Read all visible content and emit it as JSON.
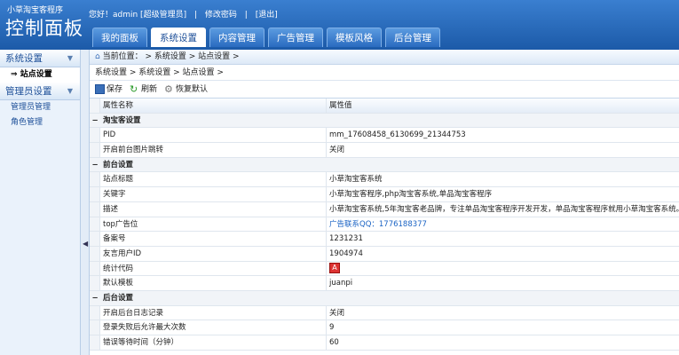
{
  "header": {
    "subtitle": "小草淘宝客程序",
    "title": "控制面板",
    "greeting": "您好！admin [超级管理员]",
    "change_password": "修改密码",
    "logout": "[退出]"
  },
  "nav": [
    "我的面板",
    "系统设置",
    "内容管理",
    "广告管理",
    "模板风格",
    "后台管理"
  ],
  "sidebar": {
    "section1": "系统设置",
    "section1_items": [
      "站点设置"
    ],
    "section2": "管理员设置",
    "section2_items": [
      "管理员管理",
      "角色管理"
    ]
  },
  "location": "当前位置： > 系统设置 > 站点设置 >",
  "breadcrumb": "系统设置 > 系统设置 > 站点设置 >",
  "toolbar": {
    "save": "保存",
    "refresh": "刷新",
    "reset": "恢复默认"
  },
  "grid": {
    "col_name": "属性名称",
    "col_value": "属性值",
    "groups": [
      {
        "name": "淘宝客设置",
        "rows": [
          {
            "k": "PID",
            "v": "mm_17608458_6130699_21344753"
          },
          {
            "k": "开启前台图片跳转",
            "v": "关闭"
          }
        ]
      },
      {
        "name": "前台设置",
        "rows": [
          {
            "k": "站点标题",
            "v": "小草淘宝客系统"
          },
          {
            "k": "关键字",
            "v": "小草淘宝客程序,php淘宝客系统,单品淘宝客程序"
          },
          {
            "k": "描述",
            "v": "小草淘宝客系统,5年淘宝客老品牌，专注单品淘宝客程序开发开发，单品淘宝客程序就用小草淘宝客系统。"
          },
          {
            "k": "top广告位",
            "v": "广告联系QQ：1776188377",
            "link": true
          },
          {
            "k": "备案号",
            "v": "1231231"
          },
          {
            "k": "友言用户ID",
            "v": "1904974"
          },
          {
            "k": "统计代码",
            "v": "",
            "icon": true
          },
          {
            "k": "默认模板",
            "v": "juanpi"
          }
        ]
      },
      {
        "name": "后台设置",
        "rows": [
          {
            "k": "开启后台日志记录",
            "v": "关闭"
          },
          {
            "k": "登录失败后允许最大次数",
            "v": "9"
          },
          {
            "k": "错误等待时间（分钟）",
            "v": "60"
          }
        ]
      }
    ]
  }
}
